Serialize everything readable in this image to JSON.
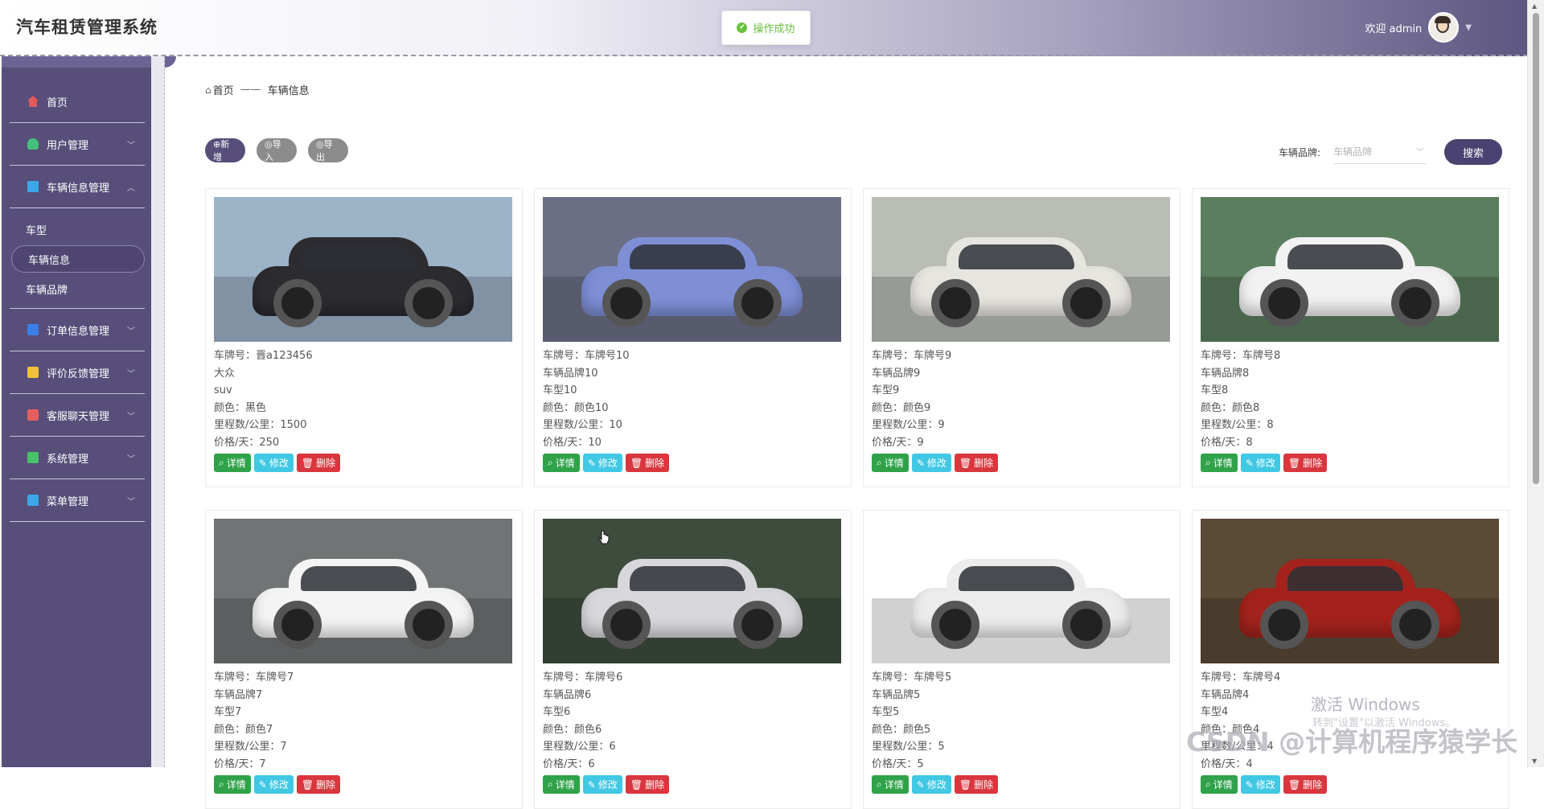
{
  "app": {
    "title": "汽车租赁管理系统"
  },
  "toast": {
    "text": "操作成功",
    "color": "#67c23a"
  },
  "header": {
    "welcome": "欢迎 admin"
  },
  "sidebar": {
    "items": [
      {
        "label": "首页",
        "icon": "home-icon",
        "color": "#e05a5a"
      },
      {
        "label": "用户管理",
        "icon": "user-icon",
        "color": "#45c07b"
      },
      {
        "label": "车辆信息管理",
        "icon": "car-icon",
        "color": "#3ba7e6",
        "children": [
          "车型",
          "车辆信息",
          "车辆品牌"
        ],
        "active_child": "车辆信息"
      },
      {
        "label": "订单信息管理",
        "icon": "order-icon",
        "color": "#3b7fe6"
      },
      {
        "label": "评价反馈管理",
        "icon": "feedback-icon",
        "color": "#f0c23b"
      },
      {
        "label": "客服聊天管理",
        "icon": "chat-icon",
        "color": "#e55e5e"
      },
      {
        "label": "系统管理",
        "icon": "system-icon",
        "color": "#49c06a"
      },
      {
        "label": "菜单管理",
        "icon": "menu-icon",
        "color": "#3ba7e6"
      }
    ]
  },
  "breadcrumb": {
    "home": "首页",
    "sep": "——",
    "current": "车辆信息"
  },
  "toolbar": {
    "add": "⊕新增",
    "import": "◎导入",
    "export": "◎导出"
  },
  "search": {
    "label": "车辆品牌:",
    "placeholder": "车辆品牌",
    "button": "搜索"
  },
  "card_actions": {
    "detail": "详情",
    "edit": "修改",
    "delete": "删除"
  },
  "cars": [
    {
      "plate": "车牌号：晋a123456",
      "brand": "大众",
      "model": "suv",
      "color": "颜色：黑色",
      "mileage": "里程数/公里：1500",
      "price": "价格/天：250",
      "paint": "#2b2b30",
      "scene": "#9db3c8"
    },
    {
      "plate": "车牌号：车牌号10",
      "brand": "车辆品牌10",
      "model": "车型10",
      "color": "颜色：颜色10",
      "mileage": "里程数/公里：10",
      "price": "价格/天：10",
      "paint": "#7e8fd6",
      "scene": "#6b6f86"
    },
    {
      "plate": "车牌号：车牌号9",
      "brand": "车辆品牌9",
      "model": "车型9",
      "color": "颜色：颜色9",
      "mileage": "里程数/公里：9",
      "price": "价格/天：9",
      "paint": "#e7e5e0",
      "scene": "#b9bdb6"
    },
    {
      "plate": "车牌号：车牌号8",
      "brand": "车辆品牌8",
      "model": "车型8",
      "color": "颜色：颜色8",
      "mileage": "里程数/公里：8",
      "price": "价格/天：8",
      "paint": "#f2f2f2",
      "scene": "#5b7e5f"
    },
    {
      "plate": "车牌号：车牌号7",
      "brand": "车辆品牌7",
      "model": "车型7",
      "color": "颜色：颜色7",
      "mileage": "里程数/公里：7",
      "price": "价格/天：7",
      "paint": "#f4f4f4",
      "scene": "#707474"
    },
    {
      "plate": "车牌号：车牌号6",
      "brand": "车辆品牌6",
      "model": "车型6",
      "color": "颜色：颜色6",
      "mileage": "里程数/公里：6",
      "price": "价格/天：6",
      "paint": "#d8d8dc",
      "scene": "#3e4c3e"
    },
    {
      "plate": "车牌号：车牌号5",
      "brand": "车辆品牌5",
      "model": "车型5",
      "color": "颜色：颜色5",
      "mileage": "里程数/公里：5",
      "price": "价格/天：5",
      "paint": "#ececec",
      "scene": "#ffffff"
    },
    {
      "plate": "车牌号：车牌号4",
      "brand": "车辆品牌4",
      "model": "车型4",
      "color": "颜色：颜色4",
      "mileage": "里程数/公里：4",
      "price": "价格/天：4",
      "paint": "#a3231c",
      "scene": "#5b4a36"
    }
  ],
  "overlay": {
    "activate": "激活 Windows",
    "activate_sub": "转到\"设置\"以激活 Windows。",
    "csdn": "CSDN @计算机程序猿学长"
  }
}
